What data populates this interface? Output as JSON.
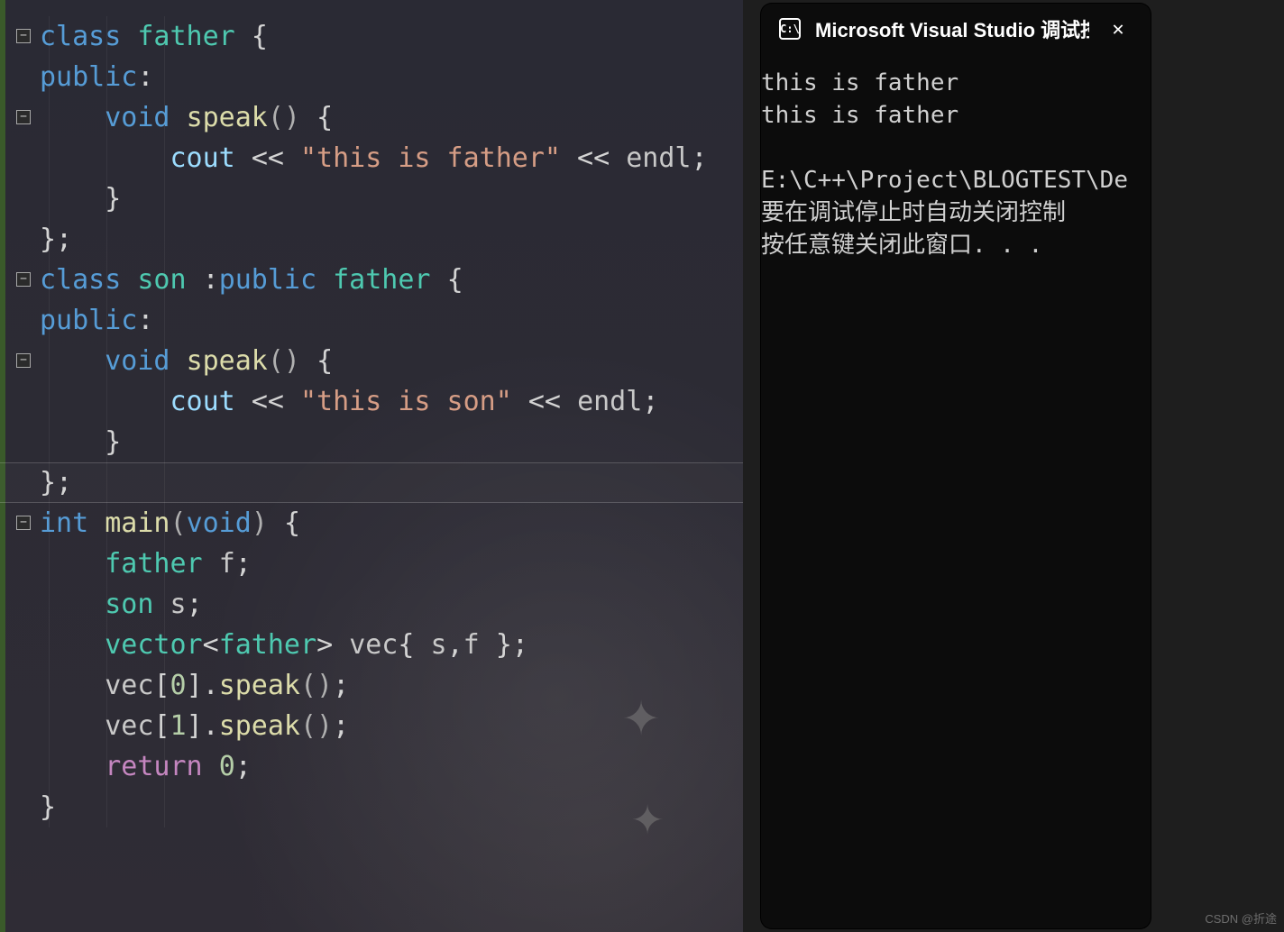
{
  "editor": {
    "fold_glyph": "⊟",
    "current_line_index": 11,
    "code_lines": [
      {
        "indent": 0,
        "tokens": [
          {
            "t": "kw",
            "v": "class"
          },
          {
            "t": "sp",
            "v": " "
          },
          {
            "t": "type",
            "v": "father"
          },
          {
            "t": "sp",
            "v": " "
          },
          {
            "t": "punct",
            "v": "{"
          }
        ]
      },
      {
        "indent": 0,
        "tokens": [
          {
            "t": "kw",
            "v": "public"
          },
          {
            "t": "punct",
            "v": ":"
          }
        ]
      },
      {
        "indent": 1,
        "tokens": [
          {
            "t": "kw",
            "v": "void"
          },
          {
            "t": "sp",
            "v": " "
          },
          {
            "t": "fn",
            "v": "speak"
          },
          {
            "t": "paren",
            "v": "()"
          },
          {
            "t": "sp",
            "v": " "
          },
          {
            "t": "punct",
            "v": "{"
          }
        ]
      },
      {
        "indent": 2,
        "tokens": [
          {
            "t": "obj",
            "v": "cout"
          },
          {
            "t": "sp",
            "v": " "
          },
          {
            "t": "punct",
            "v": "<<"
          },
          {
            "t": "sp",
            "v": " "
          },
          {
            "t": "str",
            "v": "\"this is father\""
          },
          {
            "t": "sp",
            "v": " "
          },
          {
            "t": "punct",
            "v": "<<"
          },
          {
            "t": "sp",
            "v": " "
          },
          {
            "t": "var",
            "v": "endl"
          },
          {
            "t": "punct",
            "v": ";"
          }
        ]
      },
      {
        "indent": 1,
        "tokens": [
          {
            "t": "punct",
            "v": "}"
          }
        ]
      },
      {
        "indent": 0,
        "tokens": [
          {
            "t": "punct",
            "v": "};"
          }
        ]
      },
      {
        "indent": 0,
        "tokens": [
          {
            "t": "kw",
            "v": "class"
          },
          {
            "t": "sp",
            "v": " "
          },
          {
            "t": "type",
            "v": "son"
          },
          {
            "t": "sp",
            "v": " "
          },
          {
            "t": "punct",
            "v": ":"
          },
          {
            "t": "kw",
            "v": "public"
          },
          {
            "t": "sp",
            "v": " "
          },
          {
            "t": "type",
            "v": "father"
          },
          {
            "t": "sp",
            "v": " "
          },
          {
            "t": "punct",
            "v": "{"
          }
        ]
      },
      {
        "indent": 0,
        "tokens": [
          {
            "t": "kw",
            "v": "public"
          },
          {
            "t": "punct",
            "v": ":"
          }
        ]
      },
      {
        "indent": 1,
        "tokens": [
          {
            "t": "kw",
            "v": "void"
          },
          {
            "t": "sp",
            "v": " "
          },
          {
            "t": "fn",
            "v": "speak"
          },
          {
            "t": "paren",
            "v": "()"
          },
          {
            "t": "sp",
            "v": " "
          },
          {
            "t": "punct",
            "v": "{"
          }
        ]
      },
      {
        "indent": 2,
        "tokens": [
          {
            "t": "obj",
            "v": "cout"
          },
          {
            "t": "sp",
            "v": " "
          },
          {
            "t": "punct",
            "v": "<<"
          },
          {
            "t": "sp",
            "v": " "
          },
          {
            "t": "str",
            "v": "\"this is son\""
          },
          {
            "t": "sp",
            "v": " "
          },
          {
            "t": "punct",
            "v": "<<"
          },
          {
            "t": "sp",
            "v": " "
          },
          {
            "t": "var",
            "v": "endl"
          },
          {
            "t": "punct",
            "v": ";"
          }
        ]
      },
      {
        "indent": 1,
        "tokens": [
          {
            "t": "punct",
            "v": "}"
          }
        ]
      },
      {
        "indent": 0,
        "tokens": [
          {
            "t": "punct",
            "v": "};"
          }
        ]
      },
      {
        "indent": 0,
        "tokens": [
          {
            "t": "kw",
            "v": "int"
          },
          {
            "t": "sp",
            "v": " "
          },
          {
            "t": "fn",
            "v": "main"
          },
          {
            "t": "paren",
            "v": "("
          },
          {
            "t": "kw",
            "v": "void"
          },
          {
            "t": "paren",
            "v": ")"
          },
          {
            "t": "sp",
            "v": " "
          },
          {
            "t": "punct",
            "v": "{"
          }
        ]
      },
      {
        "indent": 1,
        "tokens": [
          {
            "t": "type",
            "v": "father"
          },
          {
            "t": "sp",
            "v": " "
          },
          {
            "t": "var",
            "v": "f"
          },
          {
            "t": "punct",
            "v": ";"
          }
        ]
      },
      {
        "indent": 1,
        "tokens": [
          {
            "t": "type",
            "v": "son"
          },
          {
            "t": "sp",
            "v": " "
          },
          {
            "t": "var",
            "v": "s"
          },
          {
            "t": "punct",
            "v": ";"
          }
        ]
      },
      {
        "indent": 1,
        "tokens": [
          {
            "t": "type",
            "v": "vector"
          },
          {
            "t": "punct",
            "v": "<"
          },
          {
            "t": "type",
            "v": "father"
          },
          {
            "t": "punct",
            "v": ">"
          },
          {
            "t": "sp",
            "v": " "
          },
          {
            "t": "var",
            "v": "vec"
          },
          {
            "t": "punct",
            "v": "{"
          },
          {
            "t": "sp",
            "v": " "
          },
          {
            "t": "var",
            "v": "s"
          },
          {
            "t": "punct",
            "v": ","
          },
          {
            "t": "var",
            "v": "f"
          },
          {
            "t": "sp",
            "v": " "
          },
          {
            "t": "punct",
            "v": "}"
          },
          {
            "t": "punct",
            "v": ";"
          }
        ]
      },
      {
        "indent": 1,
        "tokens": [
          {
            "t": "var",
            "v": "vec"
          },
          {
            "t": "punct",
            "v": "["
          },
          {
            "t": "num",
            "v": "0"
          },
          {
            "t": "punct",
            "v": "]."
          },
          {
            "t": "fn",
            "v": "speak"
          },
          {
            "t": "paren",
            "v": "()"
          },
          {
            "t": "punct",
            "v": ";"
          }
        ]
      },
      {
        "indent": 1,
        "tokens": [
          {
            "t": "var",
            "v": "vec"
          },
          {
            "t": "punct",
            "v": "["
          },
          {
            "t": "num",
            "v": "1"
          },
          {
            "t": "punct",
            "v": "]."
          },
          {
            "t": "fn",
            "v": "speak"
          },
          {
            "t": "paren",
            "v": "()"
          },
          {
            "t": "punct",
            "v": ";"
          }
        ]
      },
      {
        "indent": 1,
        "tokens": [
          {
            "t": "flow",
            "v": "return"
          },
          {
            "t": "sp",
            "v": " "
          },
          {
            "t": "num",
            "v": "0"
          },
          {
            "t": "punct",
            "v": ";"
          }
        ]
      },
      {
        "indent": 0,
        "tokens": [
          {
            "t": "punct",
            "v": "}"
          }
        ]
      }
    ],
    "fold_lines": [
      0,
      2,
      6,
      8,
      12
    ]
  },
  "console": {
    "icon_text": "C:\\",
    "title": "Microsoft Visual Studio 调试控",
    "close_glyph": "✕",
    "lines": [
      "this is father",
      "this is father",
      "",
      "E:\\C++\\Project\\BLOGTEST\\De",
      "要在调试停止时自动关闭控制",
      "按任意键关闭此窗口. . ."
    ]
  },
  "watermark": "CSDN @折途"
}
